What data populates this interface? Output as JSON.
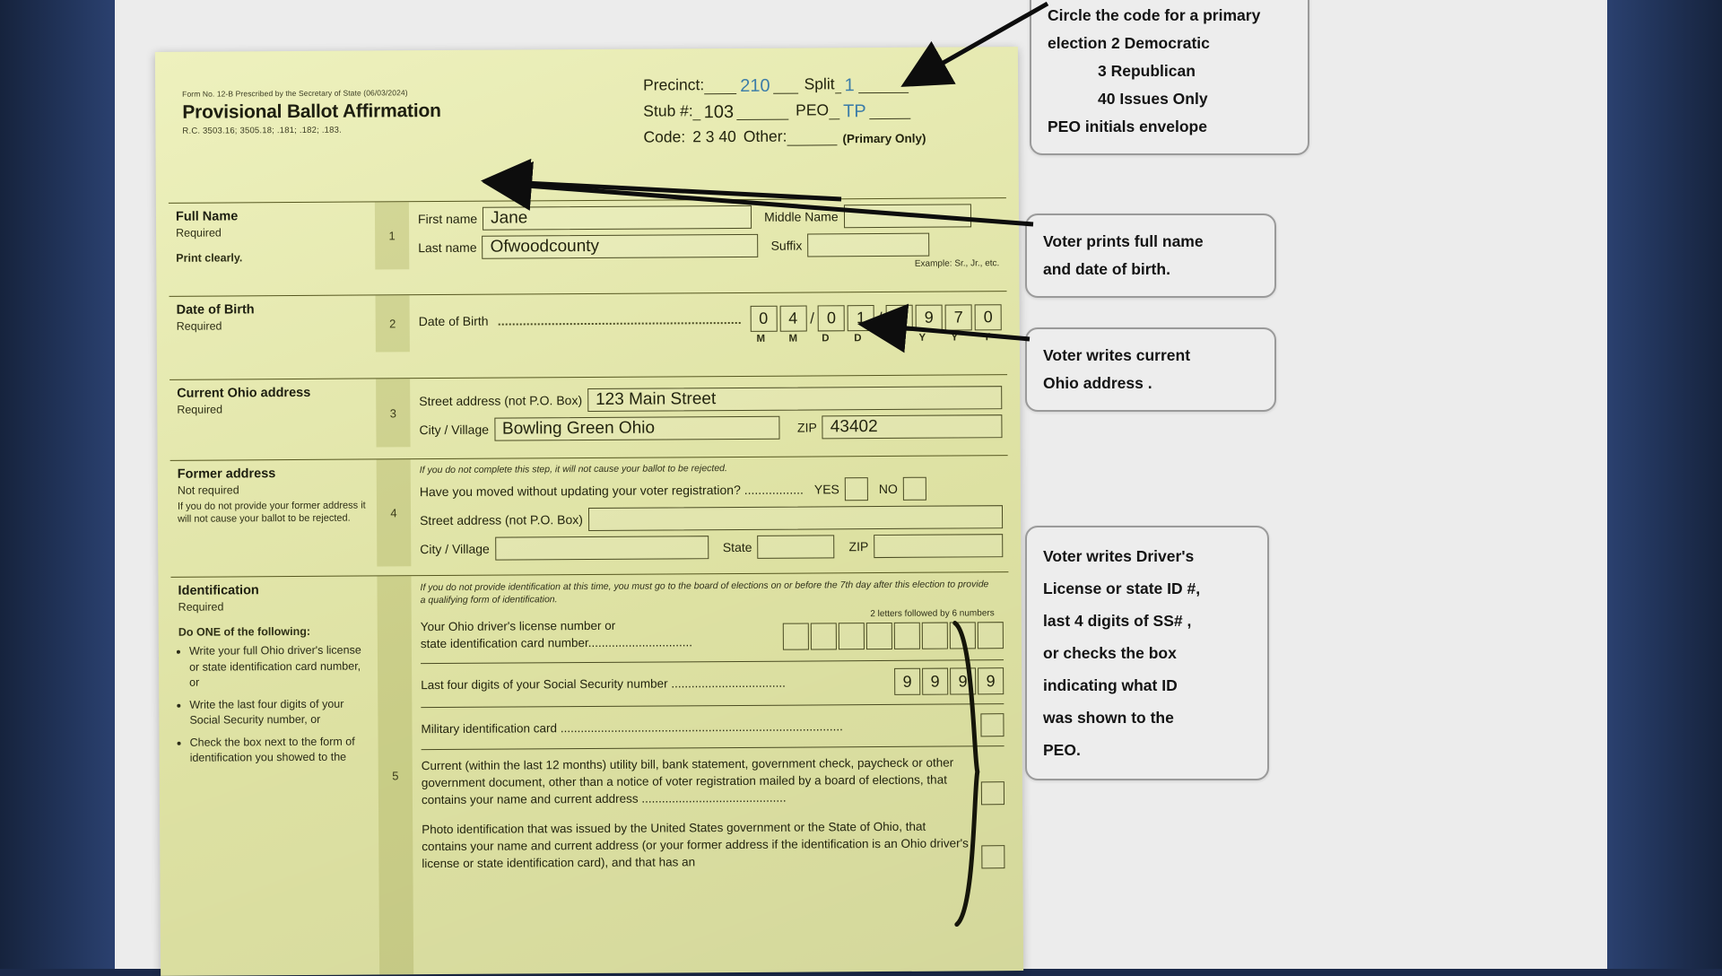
{
  "form": {
    "form_no": "Form No. 12-B Prescribed by the Secretary of State (06/03/2024)",
    "title": "Provisional Ballot Affirmation",
    "rc": "R.C. 3503.16; 3505.18; .181; .182; .183.",
    "header": {
      "precinct_label": "Precinct:",
      "precinct_value": "210",
      "split_label": "Split",
      "split_value": "1",
      "stub_label": "Stub #:",
      "stub_value": "103",
      "peo_label": "PEO",
      "peo_value": "TP",
      "code_label": "Code:",
      "code_values": "2  3  40",
      "other_label": "Other:",
      "primary_only": "(Primary Only)"
    },
    "sections": [
      {
        "num": "1",
        "title": "Full Name",
        "required": "Required",
        "note": "Print clearly.",
        "first_name_label": "First name",
        "first_name_value": "Jane",
        "middle_name_label": "Middle Name",
        "middle_name_value": "",
        "last_name_label": "Last name",
        "last_name_value": "Ofwoodcounty",
        "suffix_label": "Suffix",
        "suffix_value": "",
        "suffix_hint": "Example: Sr., Jr., etc."
      },
      {
        "num": "2",
        "title": "Date of Birth",
        "required": "Required",
        "dob_label": "Date of Birth",
        "dob_digits": [
          "0",
          "4",
          "0",
          "1",
          "1",
          "9",
          "7",
          "0"
        ],
        "dob_marks": [
          "M",
          "M",
          "D",
          "D",
          "Y",
          "Y",
          "Y",
          "Y"
        ]
      },
      {
        "num": "3",
        "title": "Current Ohio address",
        "required": "Required",
        "street_label": "Street address (not P.O. Box)",
        "street_value": "123      Main Street",
        "city_label": "City / Village",
        "city_value": "Bowling Green   Ohio",
        "zip_label": "ZIP",
        "zip_value": "43402"
      },
      {
        "num": "4",
        "title": "Former address",
        "required": "Not required",
        "note": "If you do not provide your former address it will not cause your ballot to be rejected.",
        "top_note": "If you do not complete this step, it will not cause your ballot to be rejected.",
        "moved_question": "Have you moved without updating your voter registration? .................",
        "yes_label": "YES",
        "no_label": "NO",
        "street_label": "Street address (not P.O. Box)",
        "street_value": "",
        "city_label": "City / Village",
        "city_value": "",
        "state_label": "State",
        "state_value": "",
        "zip_label": "ZIP",
        "zip_value": ""
      },
      {
        "num": "5",
        "title": "Identification",
        "required": "Required",
        "do_one": "Do ONE of the following:",
        "bullets": [
          "Write your full Ohio driver's license or state identification card number, or",
          "Write the last four digits of your Social Security number, or",
          "Check the box next to the form of identification you showed to the"
        ],
        "id_note": "If you do not provide identification at this time, you must go to the board of elections on or before the 7th day after this election to provide a qualifying form of identification.",
        "dl_line1": "Your Ohio driver's license number or",
        "dl_line2": "state identification card number...............................",
        "dl_hint": "2 letters followed by 6 numbers",
        "ssn_label": "Last four digits of your Social Security number ..................................",
        "ssn_digits": [
          "9",
          "9",
          "9",
          "9"
        ],
        "military_label": "Military identification card ....................................................................................",
        "utility_text": "Current (within the last 12 months) utility bill, bank statement, government check, paycheck or other government document, other than a notice of voter registration mailed by a board of elections, that contains your name and current address ...........................................",
        "photo_text": "Photo identification that was issued by the United States government or the State of Ohio, that contains your name and current address (or your former address if the identification is an Ohio driver's license or state identification card), and that has an"
      }
    ]
  },
  "callouts": [
    {
      "id": "code-callout",
      "line1": "Circle the code for a primary",
      "line2": "election     2 Democratic",
      "line3": "3  Republican",
      "line4": "40  Issues Only",
      "line5": "PEO initials envelope"
    },
    {
      "id": "name-dob-callout",
      "line1": "Voter prints full name",
      "line2": "and date of birth."
    },
    {
      "id": "address-callout",
      "line1": "Voter writes current",
      "line2": "Ohio address ."
    },
    {
      "id": "id-callout",
      "line1": "Voter writes Driver's",
      "line2": "License or state ID #,",
      "line3": "last 4 digits of SS# ,",
      "line4": "or checks the box",
      "line5": "indicating what ID",
      "line6": "was shown to the",
      "line7": "PEO."
    }
  ],
  "colors": {
    "paper": "#e9edab",
    "ink_blue": "#3b7ca8",
    "callout_bg": "#ededed",
    "callout_border": "#9a9a9a",
    "backdrop": "#1b2a4a"
  }
}
